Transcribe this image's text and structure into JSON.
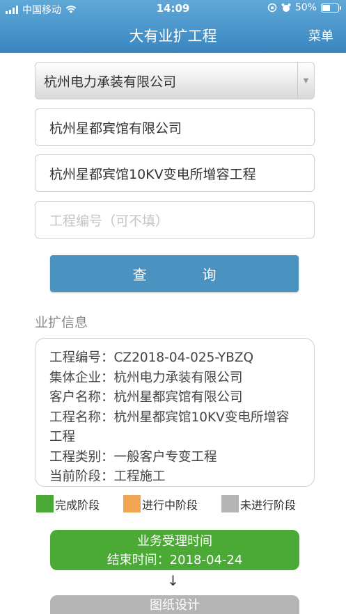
{
  "status_bar": {
    "carrier": "中国移动",
    "time": "14:09",
    "battery": "50%",
    "battery_level": 0.5
  },
  "header": {
    "title": "大有业扩工程",
    "menu_label": "菜单"
  },
  "form": {
    "company_select": "杭州电力承装有限公司",
    "customer_name": "杭州星都宾馆有限公司",
    "project_name": "杭州星都宾馆10KV变电所增容工程",
    "project_no_placeholder": "工程编号（可不填）",
    "query_char_1": "查",
    "query_char_2": "询"
  },
  "info": {
    "section_title": "业扩信息",
    "rows": [
      "工程编号：CZ2018-04-025-YBZQ",
      "集体企业：杭州电力承装有限公司",
      "客户名称：杭州星都宾馆有限公司",
      "工程名称：杭州星都宾馆10KV变电所增容工程",
      "工程类别：一般客户专变工程",
      "当前阶段：工程施工"
    ]
  },
  "legend": {
    "done": "完成阶段",
    "in_progress": "进行中阶段",
    "pending": "未进行阶段",
    "colors": {
      "done": "#4aaa35",
      "in_progress": "#f2a552",
      "pending": "#b5b5b5"
    }
  },
  "stages": [
    {
      "name": "业务受理时间",
      "end_time": "结束时间：2018-04-24",
      "state": "done"
    },
    {
      "name": "图纸设计",
      "state": "pending"
    }
  ],
  "arrow_glyph": "↓"
}
